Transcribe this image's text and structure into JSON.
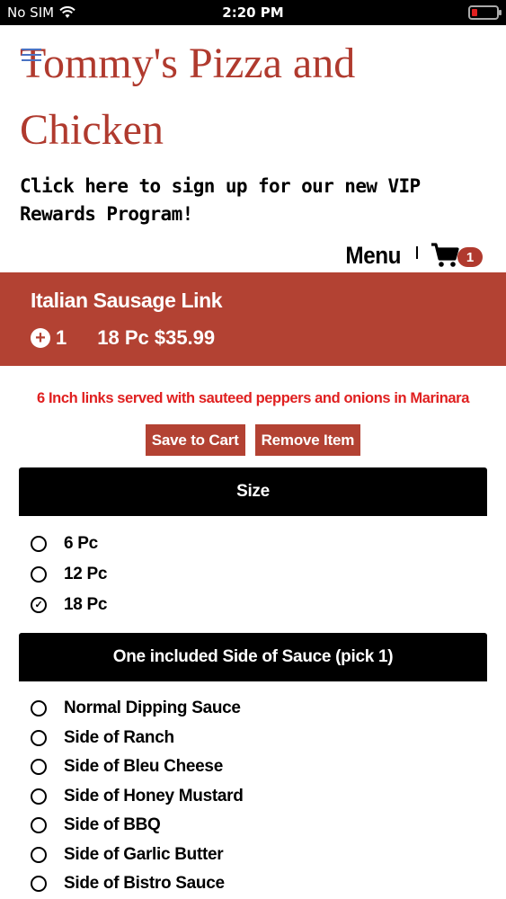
{
  "status_bar": {
    "carrier": "No SIM",
    "time": "2:20 PM"
  },
  "header": {
    "brand": "Tommy's Pizza and Chicken",
    "vip_text": "Click here to sign up for our new VIP Rewards Program!",
    "menu_label": "Menu",
    "cart_count": "1"
  },
  "item": {
    "name": "Italian Sausage Link",
    "quantity": "1",
    "selection_price": "18 Pc $35.99",
    "description": "6 Inch links served with sauteed peppers and onions in Marinara"
  },
  "actions": {
    "save_label": "Save to Cart",
    "remove_label": "Remove Item"
  },
  "sections": {
    "size": {
      "title": "Size",
      "options": [
        {
          "label": "6 Pc",
          "checked": false
        },
        {
          "label": "12 Pc",
          "checked": false
        },
        {
          "label": "18 Pc",
          "checked": true
        }
      ]
    },
    "sauce": {
      "title": "One included Side of Sauce (pick 1)",
      "options": [
        {
          "label": "Normal Dipping Sauce",
          "checked": false
        },
        {
          "label": "Side of Ranch",
          "checked": false
        },
        {
          "label": "Side of Bleu Cheese",
          "checked": false
        },
        {
          "label": "Side of Honey Mustard",
          "checked": false
        },
        {
          "label": "Side of BBQ",
          "checked": false
        },
        {
          "label": "Side of Garlic Butter",
          "checked": false
        },
        {
          "label": "Side of Bistro Sauce",
          "checked": false
        }
      ]
    }
  },
  "colors": {
    "accent": "#b34233",
    "brand_text": "#b03a2e",
    "description_text": "#e02020"
  }
}
